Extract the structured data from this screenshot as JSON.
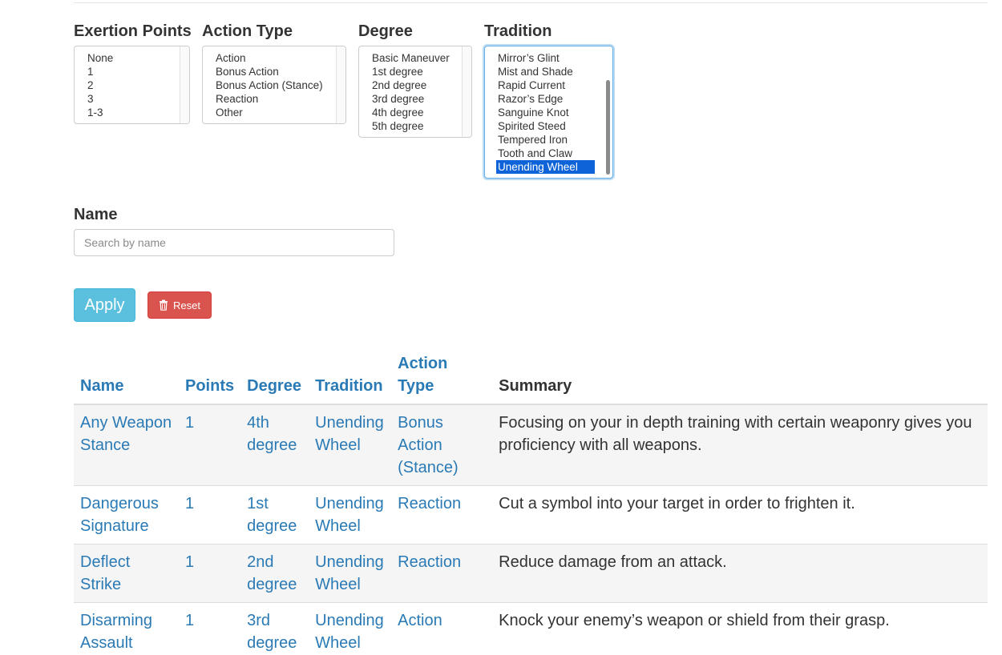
{
  "filters": {
    "exertion": {
      "label": "Exertion Points",
      "options": [
        "None",
        "1",
        "2",
        "3",
        "1-3"
      ]
    },
    "action_type": {
      "label": "Action Type",
      "options": [
        "Action",
        "Bonus Action",
        "Bonus Action (Stance)",
        "Reaction",
        "Other"
      ]
    },
    "degree": {
      "label": "Degree",
      "options": [
        "Basic Maneuver",
        "1st degree",
        "2nd degree",
        "3rd degree",
        "4th degree",
        "5th degree"
      ]
    },
    "tradition": {
      "label": "Tradition",
      "options": [
        "Mirror’s Glint",
        "Mist and Shade",
        "Rapid Current",
        "Razor’s Edge",
        "Sanguine Knot",
        "Spirited Steed",
        "Tempered Iron",
        "Tooth and Claw",
        "Unending Wheel"
      ],
      "selected": "Unending Wheel"
    }
  },
  "name_filter": {
    "label": "Name",
    "placeholder": "Search by name",
    "value": ""
  },
  "buttons": {
    "apply": "Apply",
    "reset": "Reset"
  },
  "icons": {
    "reset": "trash-icon"
  },
  "colors": {
    "link": "#2a7ab5",
    "apply": "#5bc0de",
    "reset": "#d9534f",
    "selected_option": "#0f63d8"
  },
  "table": {
    "headers": {
      "name": "Name",
      "points": "Points",
      "degree": "Degree",
      "tradition": "Tradition",
      "action_type": "Action Type",
      "summary": "Summary"
    },
    "rows": [
      {
        "name": "Any Weapon Stance",
        "points": "1",
        "degree": "4th degree",
        "tradition": "Unending Wheel",
        "action_type": "Bonus Action (Stance)",
        "summary": "Focusing on your in depth training with certain weaponry gives you proficiency with all weapons."
      },
      {
        "name": "Dangerous Signature",
        "points": "1",
        "degree": "1st degree",
        "tradition": "Unending Wheel",
        "action_type": "Reaction",
        "summary": "Cut a symbol into your target in order to frighten it."
      },
      {
        "name": "Deflect Strike",
        "points": "1",
        "degree": "2nd degree",
        "tradition": "Unending Wheel",
        "action_type": "Reaction",
        "summary": "Reduce damage from an attack."
      },
      {
        "name": "Disarming Assault",
        "points": "1",
        "degree": "3rd degree",
        "tradition": "Unending Wheel",
        "action_type": "Action",
        "summary": "Knock your enemy’s weapon or shield from their grasp."
      }
    ]
  }
}
